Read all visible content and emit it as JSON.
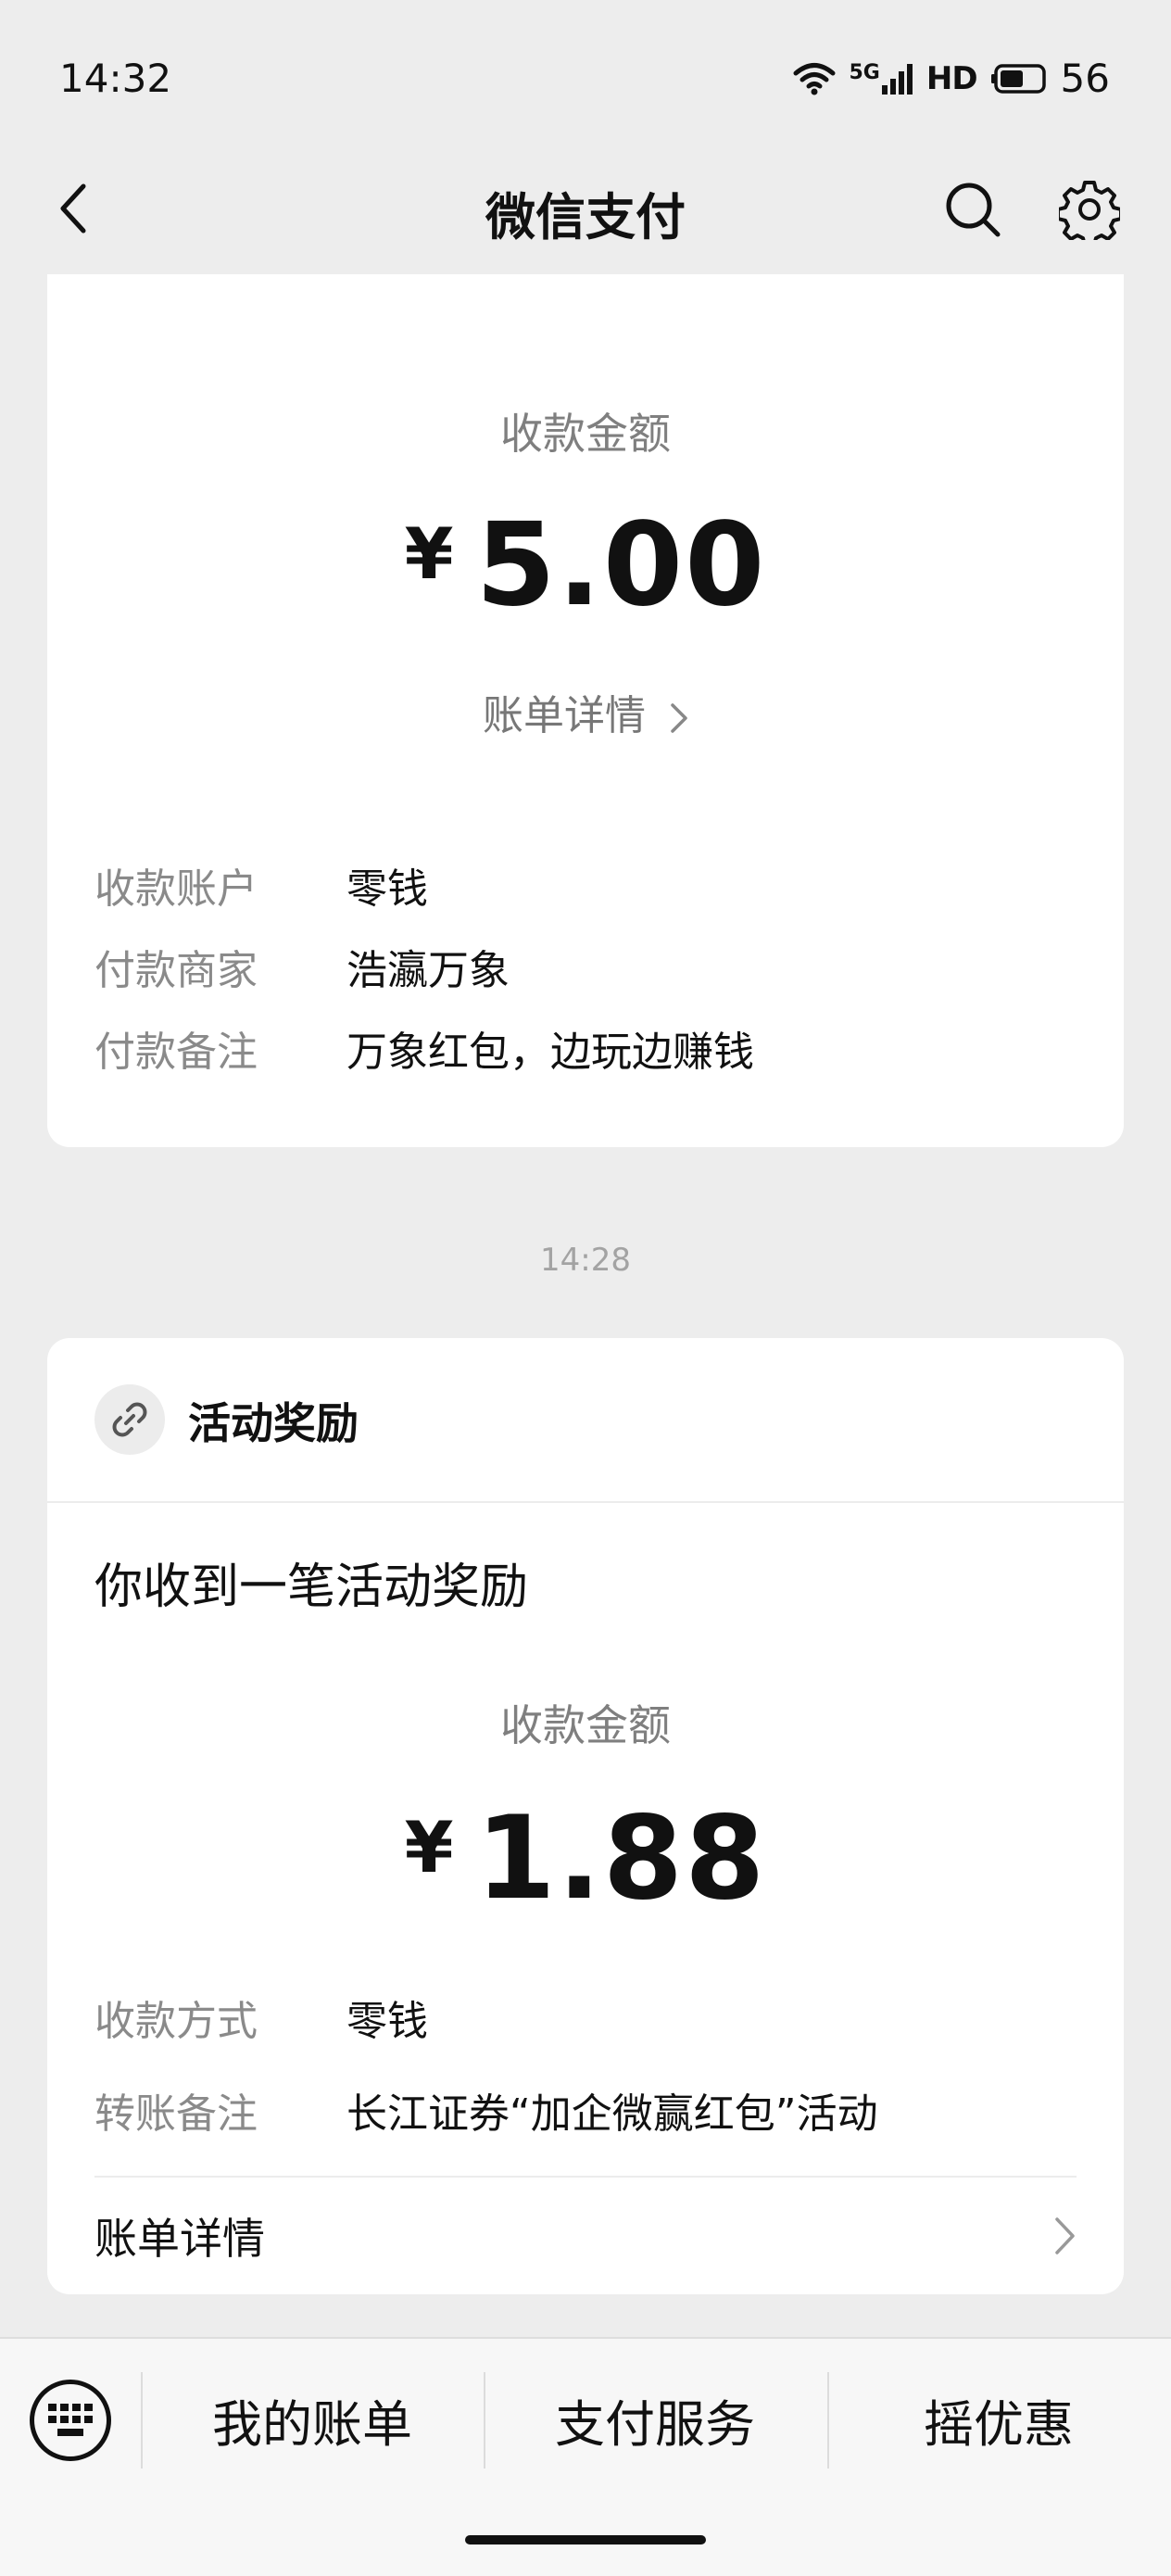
{
  "status": {
    "time": "14:32",
    "network": "5G",
    "hd": "HD",
    "battery": "56"
  },
  "nav": {
    "title": "微信支付"
  },
  "card1": {
    "amount_label": "收款金额",
    "currency": "¥",
    "amount": "5.00",
    "bill_link": "账单详情",
    "rows": [
      {
        "key": "收款账户",
        "value": "零钱"
      },
      {
        "key": "付款商家",
        "value": "浩瀛万象"
      },
      {
        "key": "付款备注",
        "value": "万象红包，边玩边赚钱"
      }
    ]
  },
  "divider_time": "14:28",
  "card2": {
    "header_title": "活动奖励",
    "subtitle": "你收到一笔活动奖励",
    "amount_label": "收款金额",
    "currency": "¥",
    "amount": "1.88",
    "rows": [
      {
        "key": "收款方式",
        "value": "零钱"
      },
      {
        "key": "转账备注",
        "value": "长江证券“加企微赢红包”活动"
      }
    ],
    "bill_row_label": "账单详情"
  },
  "bottom_menu": {
    "items": [
      "我的账单",
      "支付服务",
      "摇优惠"
    ]
  }
}
